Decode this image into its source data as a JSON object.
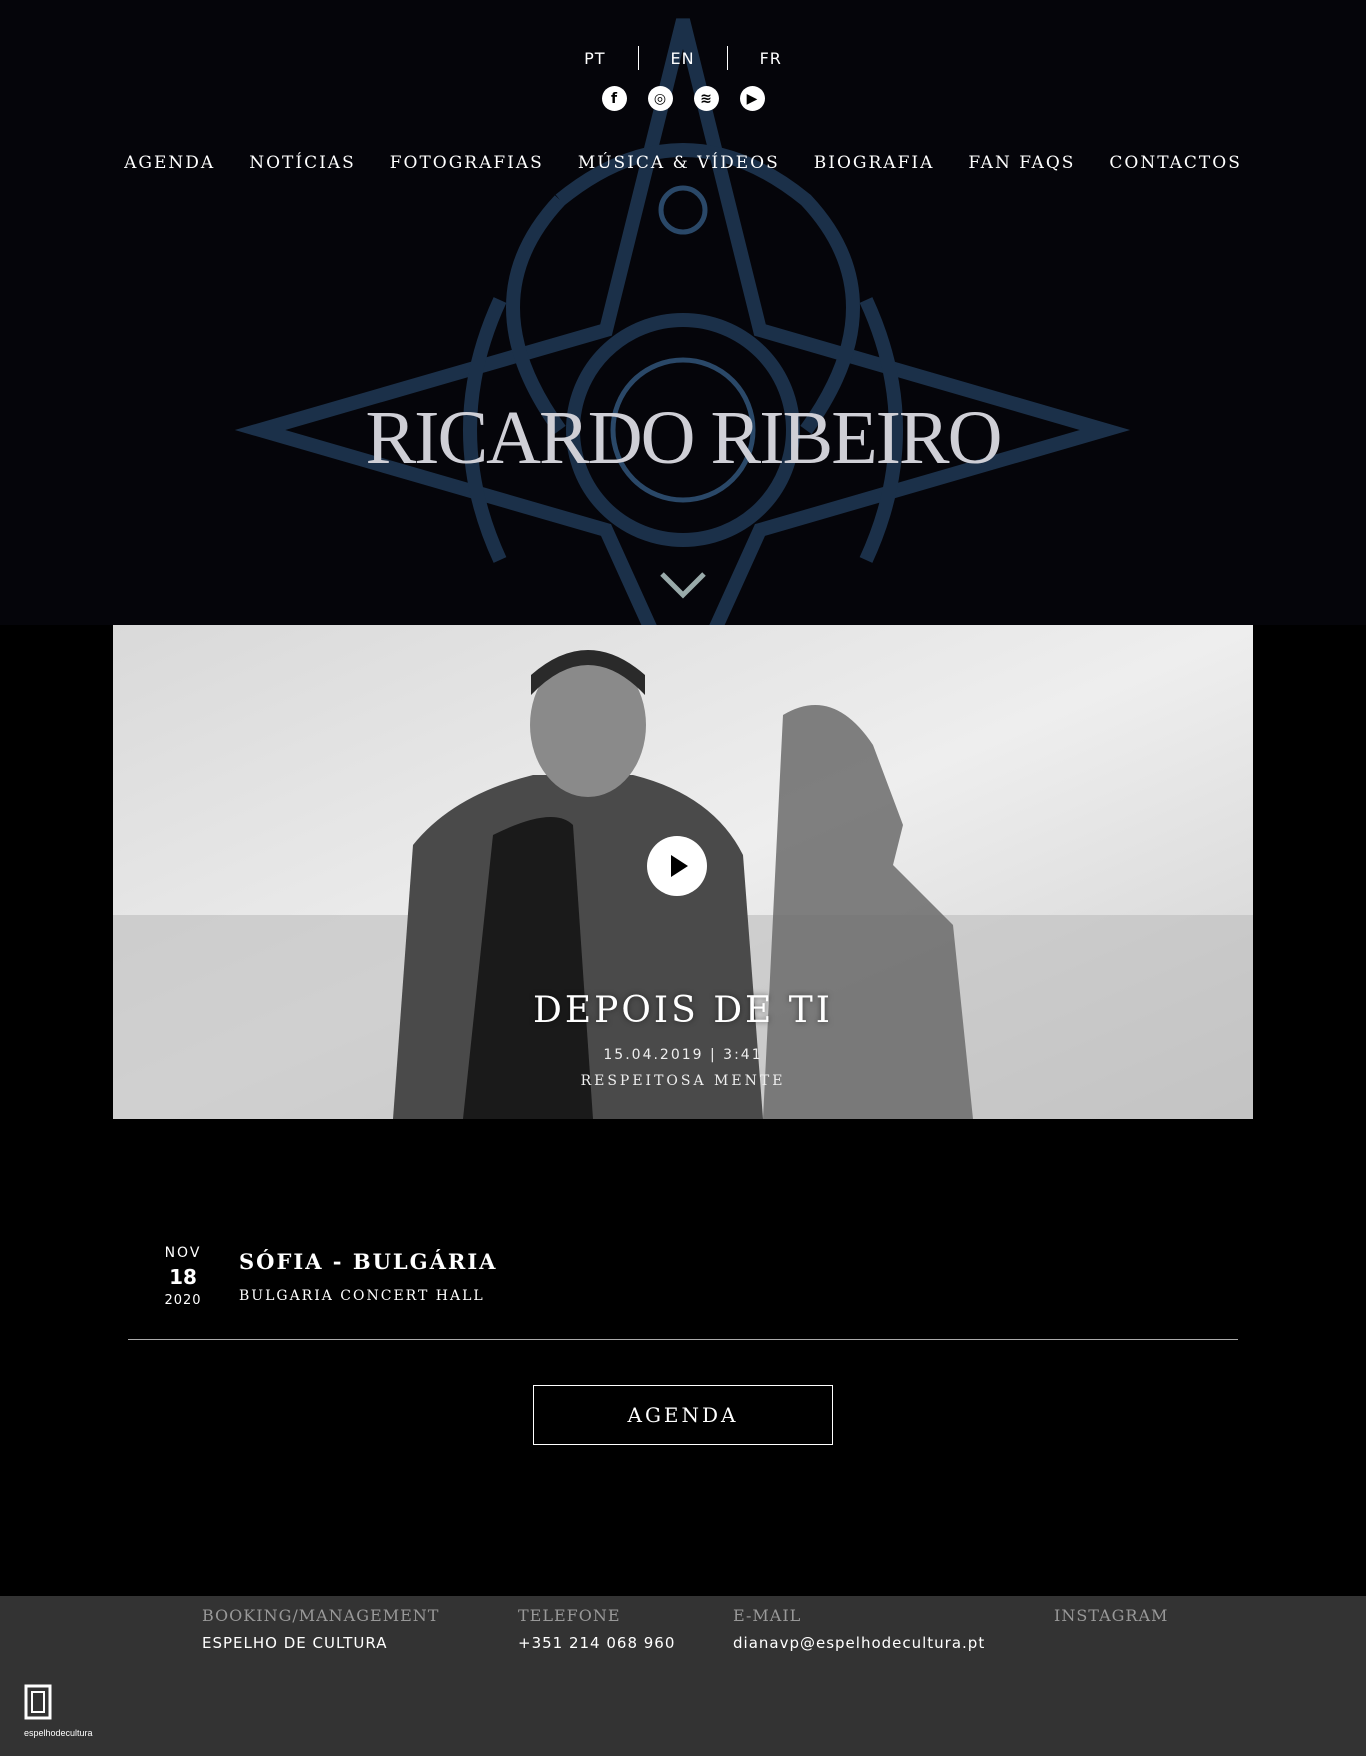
{
  "languages": [
    "PT",
    "EN",
    "FR"
  ],
  "social": [
    {
      "name": "facebook-icon",
      "glyph": "f"
    },
    {
      "name": "instagram-icon",
      "glyph": "◎"
    },
    {
      "name": "spotify-icon",
      "glyph": "≋"
    },
    {
      "name": "youtube-icon",
      "glyph": "▶"
    }
  ],
  "nav": [
    "AGENDA",
    "NOTÍCIAS",
    "FOTOGRAFIAS",
    "MÚSICA & VÍDEOS",
    "BIOGRAFIA",
    "FAN FAQS",
    "CONTACTOS"
  ],
  "hero": {
    "logo": "RICARDO RIBEIRO"
  },
  "video": {
    "title": "DEPOIS DE TI",
    "meta": "15.04.2019 | 3:41",
    "album": "RESPEITOSA MENTE"
  },
  "event": {
    "month": "NOV",
    "day": "18",
    "year": "2020",
    "city": "SÓFIA - BULGÁRIA",
    "venue": "BULGARIA CONCERT HALL"
  },
  "agenda_button": "AGENDA",
  "footer": {
    "booking_label": "BOOKING/MANAGEMENT",
    "booking_value": "ESPELHO DE CULTURA",
    "phone_label": "TELEFONE",
    "phone_value": "+351 214 068 960",
    "email_label": "E-MAIL",
    "email_value": "dianavp@espelhodecultura.pt",
    "instagram_label": "INSTAGRAM",
    "logo_text": "espelhodecultura"
  }
}
